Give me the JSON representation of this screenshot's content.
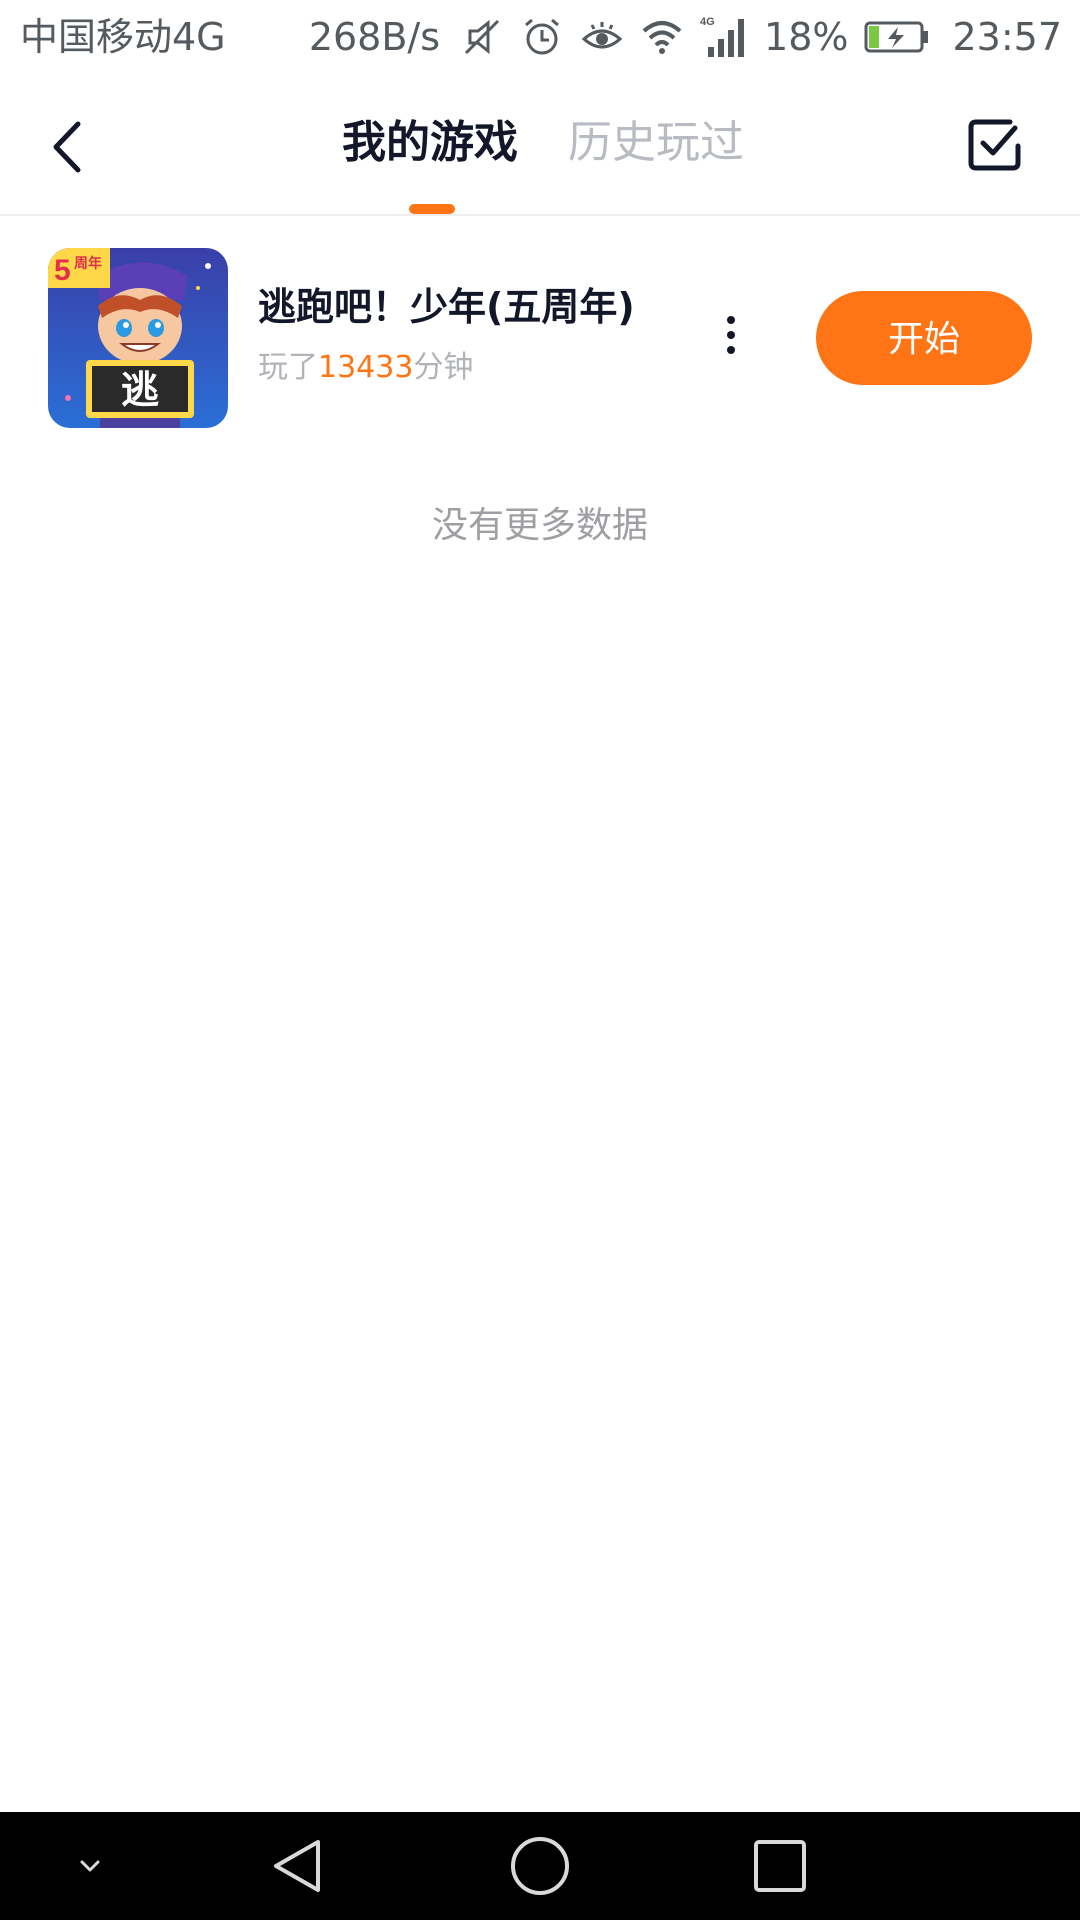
{
  "status_bar": {
    "carrier": "中国移动4G",
    "net_speed": "268B/s",
    "network_type": "4G",
    "battery_percent": "18%",
    "time": "23:57",
    "icons": [
      "mute-icon",
      "alarm-icon",
      "eye-comfort-icon",
      "wifi-icon",
      "signal-icon",
      "battery-charging-icon"
    ]
  },
  "header": {
    "tabs": [
      {
        "label": "我的游戏",
        "selected": true
      },
      {
        "label": "历史玩过",
        "selected": false
      }
    ],
    "back_icon": "back-arrow-icon",
    "manage_icon": "checkbox-checked-icon",
    "accent_color": "#ff7414"
  },
  "games": [
    {
      "title": "逃跑吧！少年(五周年)",
      "played_prefix": "玩了",
      "played_minutes": "13433",
      "played_suffix": "分钟",
      "icon_badge": "5周年",
      "icon_sign": "逃",
      "start_label": "开始"
    }
  ],
  "list_end_text": "没有更多数据",
  "nav_bar": {
    "icons": [
      "hide-nav-icon",
      "back-triangle-icon",
      "home-circle-icon",
      "recents-square-icon"
    ]
  }
}
